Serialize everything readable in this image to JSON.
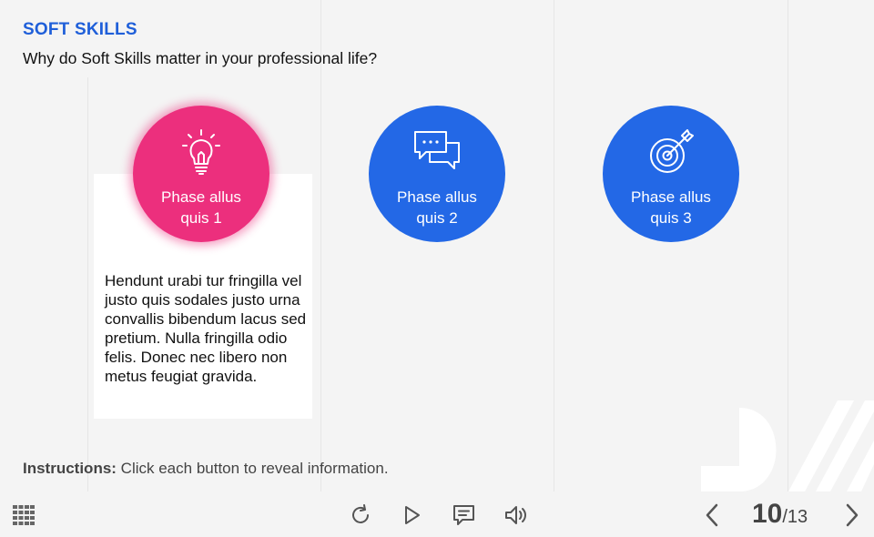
{
  "header": {
    "title": "SOFT SKILLS",
    "subtitle": "Why do Soft Skills matter in your professional life?"
  },
  "colors": {
    "title_blue": "#1f5fd9",
    "phase_blue": "#2368e6",
    "phase_pink": "#ec2f7d",
    "background": "#f4f4f4"
  },
  "phases": [
    {
      "label": "Phase allus quis 1",
      "icon": "lightbulb-icon",
      "active": true
    },
    {
      "label": "Phase allus quis 2",
      "icon": "chat-bubbles-icon",
      "active": false
    },
    {
      "label": "Phase allus quis 3",
      "icon": "target-arrow-icon",
      "active": false
    }
  ],
  "panel": {
    "text": "Hendunt urabi tur fringilla vel justo quis sodales justo urna convallis bibendum lacus sed pretium. Nulla fringilla odio felis. Donec nec libero non metus feugiat gravida."
  },
  "instructions": {
    "prefix": "Instructions:",
    "text": " Click each button to reveal information."
  },
  "toolbar": {
    "menu_icon": "grid-menu-icon",
    "replay_icon": "replay-icon",
    "play_icon": "play-icon",
    "captions_icon": "captions-icon",
    "volume_icon": "volume-icon",
    "prev_icon": "chevron-left-icon",
    "next_icon": "chevron-right-icon"
  },
  "pager": {
    "current": "10",
    "total": "/13"
  }
}
